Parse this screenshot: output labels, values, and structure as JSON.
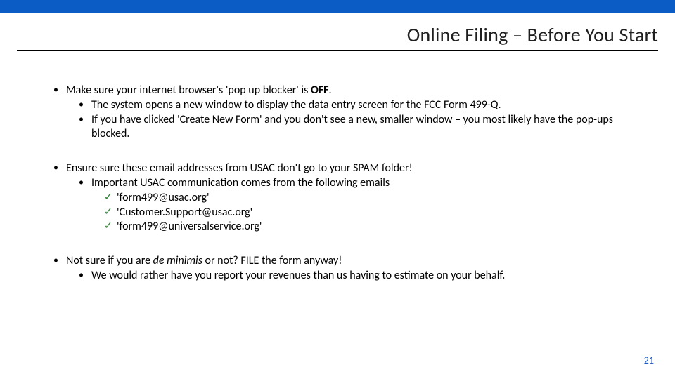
{
  "header": {
    "title": "Online Filing – Before You Start"
  },
  "content": {
    "blocks": [
      {
        "lead_pre": "Make sure your internet browser's 'pop up blocker' is ",
        "lead_bold": "OFF",
        "lead_post": ".",
        "subs": [
          "The system opens a new window to display the data entry screen for the FCC Form 499-Q.",
          "If you have clicked 'Create New Form' and you don't see a new, smaller window – you most likely have the pop-ups blocked."
        ]
      },
      {
        "lead": "Ensure sure these email addresses from USAC don't go to your SPAM folder!",
        "subs": [
          "Important USAC communication comes from the following emails"
        ],
        "checks": [
          "'form499@usac.org'",
          "'Customer.Support@usac.org'",
          "'form499@universalservice.org'"
        ]
      },
      {
        "lead_pre": "Not sure if you are ",
        "lead_italic": "de minimis",
        "lead_post": " or not?  FILE the form anyway!",
        "subs": [
          "We would rather have you report your revenues than us having to estimate on your behalf."
        ]
      }
    ]
  },
  "page_number": "21"
}
